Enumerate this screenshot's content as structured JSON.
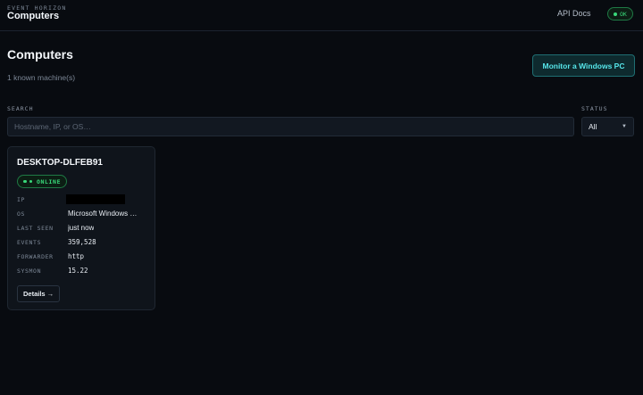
{
  "header": {
    "brand_small": "EVENT HORIZON",
    "brand_title": "Computers",
    "api_docs": "API Docs",
    "status_ok": "OK"
  },
  "page": {
    "title": "Computers",
    "subtitle": "1 known machine(s)",
    "monitor_button": "Monitor a Windows PC"
  },
  "filters": {
    "search_label": "SEARCH",
    "search_placeholder": "Hostname, IP, or OS…",
    "search_value": "",
    "status_label": "STATUS",
    "status_value": "All"
  },
  "computers": [
    {
      "hostname": "DESKTOP-DLFEB91",
      "status": "ONLINE",
      "fields": {
        "ip_label": "IP",
        "ip_value": "",
        "os_label": "OS",
        "os_value": "Microsoft Windows …",
        "last_seen_label": "LAST SEEN",
        "last_seen_value": "just now",
        "events_label": "EVENTS",
        "events_value": "359,528",
        "forwarder_label": "FORWARDER",
        "forwarder_value": "http",
        "sysmon_label": "SYSMON",
        "sysmon_value": "15.22"
      },
      "details_button": "Details →"
    }
  ],
  "colors": {
    "background": "#080b10",
    "card": "#0f141b",
    "accent": "#56e6ea",
    "online": "#39d97a"
  }
}
